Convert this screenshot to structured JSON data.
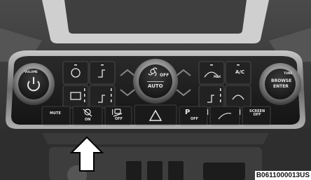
{
  "labels": {
    "volume": "VOLUME",
    "off": "OFF",
    "auto": "AUTO",
    "mute": "MUTE",
    "stop_start_on": "ON",
    "hill_descent_off": "OFF",
    "park_assist_off": "OFF",
    "park_p": "P",
    "screen_off": "SCREEN\nOFF",
    "tune": "TUNE",
    "browse": "BROWSE",
    "enter": "ENTER",
    "max": "MAX",
    "ac": "A/C"
  },
  "image_code": "B0611000013US",
  "colors": {
    "dash": "#2b2b2b",
    "panel": "#1c1c1c",
    "label": "#e6e6e6",
    "arrow": "#ffffff"
  },
  "icons": [
    "power-icon",
    "fan-icon",
    "heated-steering-icon",
    "heated-seat-icon",
    "rear-defrost-icon",
    "front-defrost-icon",
    "max-defrost-icon",
    "recirculation-icon",
    "hazard-icon",
    "stop-start-icon",
    "hill-descent-icon",
    "park-assist-icon",
    "lane-icon",
    "up-arrow-icon"
  ]
}
